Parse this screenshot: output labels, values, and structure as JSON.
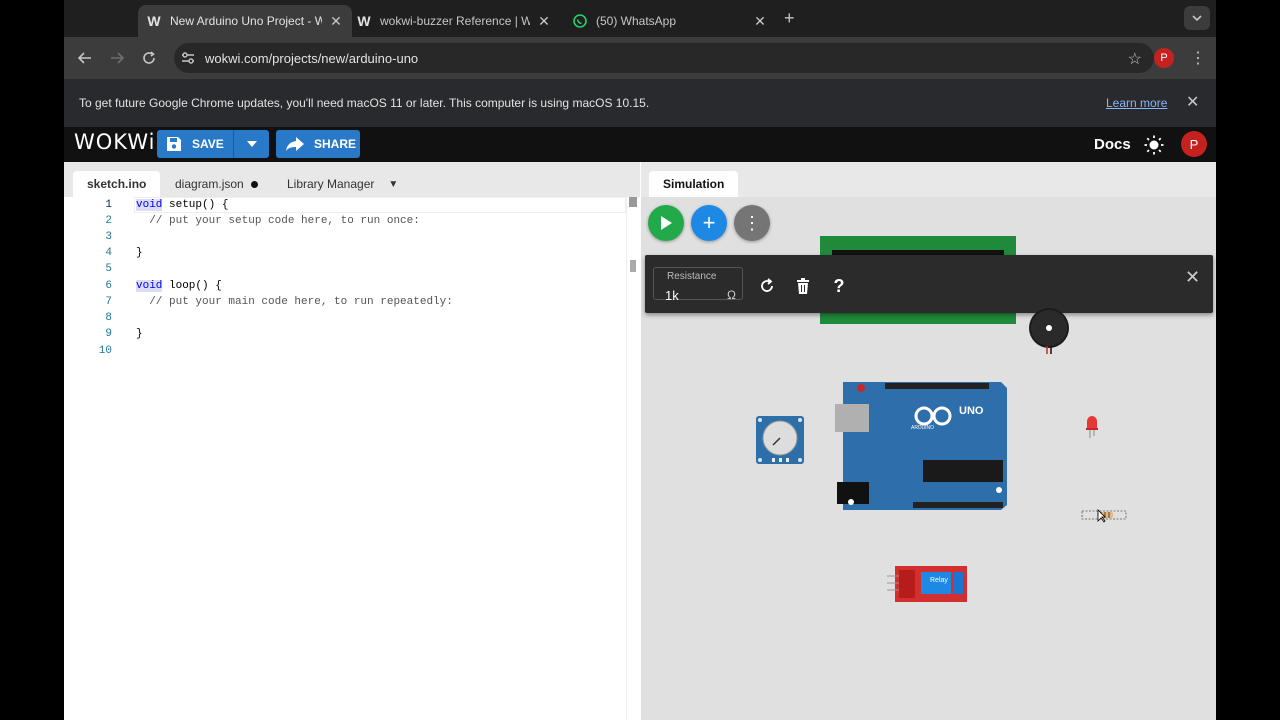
{
  "browser": {
    "tabs": [
      {
        "title": "New Arduino Uno Project - W",
        "favicon": "wokwi-icon"
      },
      {
        "title": "wokwi-buzzer Reference | Wo",
        "favicon": "wokwi-icon"
      },
      {
        "title": "(50) WhatsApp",
        "favicon": "whatsapp-icon"
      }
    ],
    "url": "wokwi.com/projects/new/arduino-uno",
    "profile_initial": "P"
  },
  "infobar": {
    "message": "To get future Google Chrome updates, you'll need macOS 11 or later. This computer is using macOS 10.15.",
    "link": "Learn more"
  },
  "header": {
    "logo": "WOKWi",
    "save_label": "SAVE",
    "share_label": "SHARE",
    "docs_label": "Docs",
    "profile_initial": "P",
    "accent_color": "#2979c9"
  },
  "editor": {
    "tabs": [
      "sketch.ino",
      "diagram.json",
      "Library Manager"
    ],
    "line_numbers": [
      "1",
      "2",
      "3",
      "4",
      "5",
      "6",
      "7",
      "8",
      "9",
      "10"
    ],
    "lines": [
      {
        "kw": "void",
        "rest": " setup() {"
      },
      {
        "text": "  // put your setup code here, to run once:"
      },
      {
        "text": ""
      },
      {
        "text": "}"
      },
      {
        "text": ""
      },
      {
        "kw": "void",
        "rest": " loop() {"
      },
      {
        "text": "  // put your main code here, to run repeatedly:"
      },
      {
        "text": ""
      },
      {
        "text": "}"
      },
      {
        "text": ""
      }
    ]
  },
  "simulation": {
    "tab_label": "Simulation",
    "resistance": {
      "label": "Resistance",
      "value": "1k",
      "unit": "Ω"
    },
    "board_label": "UNO",
    "board_sublabel": "ARDUINO",
    "relay_label": "Relay"
  }
}
